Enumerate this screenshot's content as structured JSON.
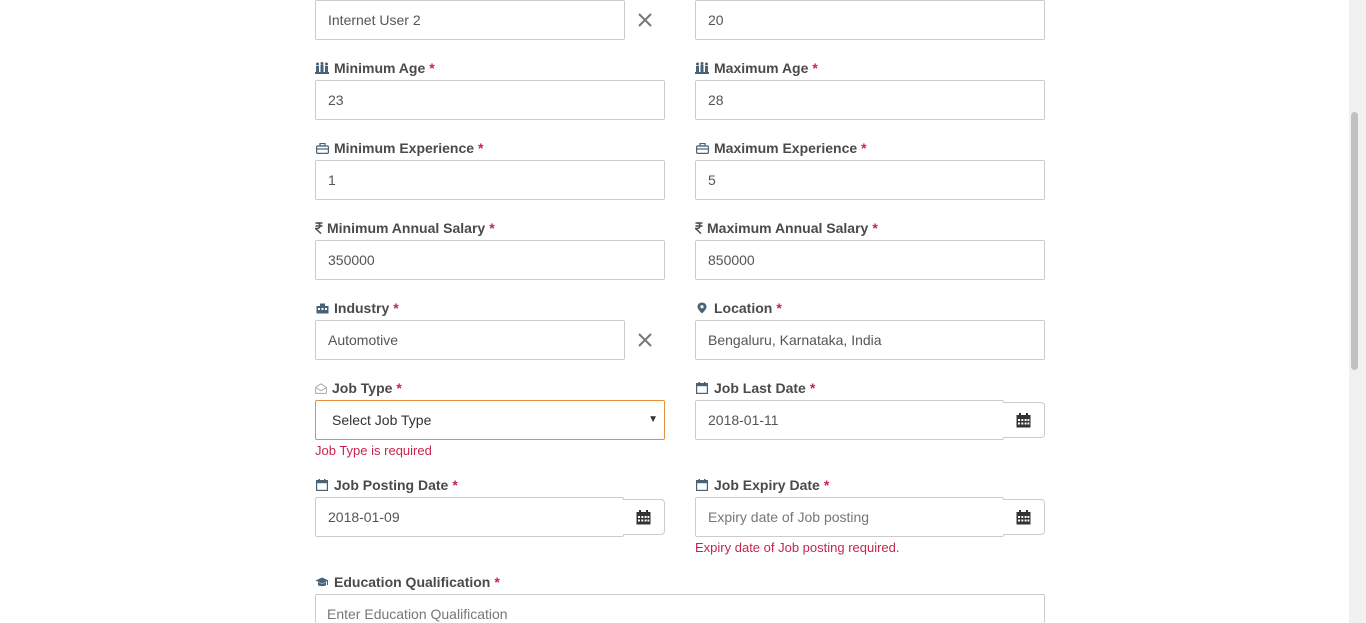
{
  "required_mark": "*",
  "top_row": {
    "left_value": "Internet User 2",
    "right_value": "20"
  },
  "fields": {
    "min_age": {
      "label": "Minimum Age",
      "value": "23"
    },
    "max_age": {
      "label": "Maximum Age",
      "value": "28"
    },
    "min_experience": {
      "label": "Minimum Experience",
      "value": "1"
    },
    "max_experience": {
      "label": "Maximum Experience",
      "value": "5"
    },
    "min_salary": {
      "label": "Minimum Annual Salary",
      "value": "350000"
    },
    "max_salary": {
      "label": "Maximum Annual Salary",
      "value": "850000"
    },
    "industry": {
      "label": "Industry",
      "value": "Automotive"
    },
    "location": {
      "label": "Location",
      "value": "Bengaluru, Karnataka, India"
    },
    "job_type": {
      "label": "Job Type",
      "selected": "Select Job Type",
      "error": "Job Type is required"
    },
    "job_last_date": {
      "label": "Job Last Date",
      "value": "2018-01-11"
    },
    "job_posting_date": {
      "label": "Job Posting Date",
      "value": "2018-01-09"
    },
    "job_expiry_date": {
      "label": "Job Expiry Date",
      "placeholder": "Expiry date of Job posting",
      "error": "Expiry date of Job posting required."
    },
    "education": {
      "label": "Education Qualification",
      "placeholder": "Enter Education Qualification"
    }
  },
  "icons": {
    "age": "users-icon",
    "experience": "briefcase-icon",
    "salary": "rupee-icon",
    "industry": "building-icon",
    "location": "map-marker-icon",
    "job_type": "envelope-open-icon",
    "date": "calendar-icon",
    "education": "graduation-cap-icon",
    "clear": "close-icon",
    "caret": "caret-down-icon"
  },
  "colors": {
    "error": "#c7254e",
    "label": "#4a4a4a",
    "focus_border": "#e0913a",
    "icon": "#4a6275"
  }
}
